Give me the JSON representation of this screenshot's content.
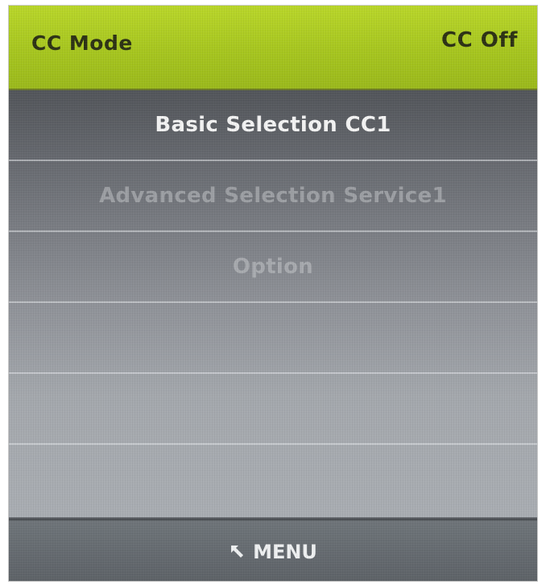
{
  "header": {
    "mode_title": "CC Mode",
    "status": "CC Off"
  },
  "menu": {
    "items": [
      {
        "label": "Basic Selection CC1",
        "state": "active"
      },
      {
        "label": "Advanced Selection Service1",
        "state": "disabled"
      },
      {
        "label": "Option",
        "state": "disabled"
      },
      {
        "label": "",
        "state": "empty"
      },
      {
        "label": "",
        "state": "empty"
      },
      {
        "label": "",
        "state": "empty"
      }
    ]
  },
  "footer": {
    "menu_label": "MENU",
    "back_icon": "return-arrow-icon"
  },
  "colors": {
    "header_green": "#a9c722",
    "text_dark": "#2d3215",
    "text_active": "#f3f3f3"
  }
}
